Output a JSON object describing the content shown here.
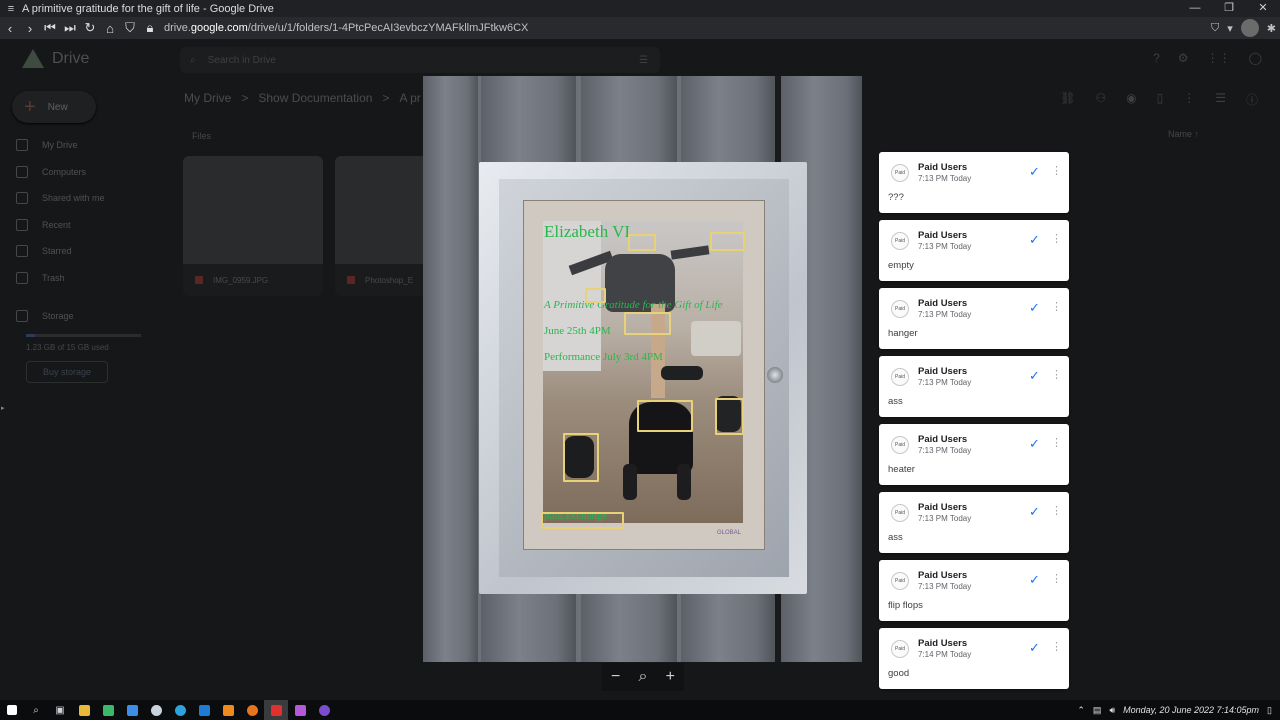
{
  "window": {
    "title": "A primitive gratitude for the gift of life - Google Drive",
    "controls": [
      "—",
      "❐",
      "✕"
    ]
  },
  "browser": {
    "url_prefix": "drive.",
    "url_host": "google.com",
    "url_path": "/drive/u/1/folders/1-4PtcPecAI3evbczYMAFkllmJFtkw6CX"
  },
  "drive": {
    "logo_text": "Drive",
    "new_label": "New",
    "search_placeholder": "Search in Drive",
    "nav": [
      "My Drive",
      "Computers",
      "Shared with me",
      "Recent",
      "Starred",
      "Trash"
    ],
    "storage_label": "Storage",
    "storage_used": "1.23 GB of 15 GB used",
    "storage_fraction": 0.082,
    "buy_storage": "Buy storage",
    "breadcrumb": [
      "My Drive",
      ">",
      "Show Documentation",
      ">",
      "A pr"
    ],
    "files_label": "Files",
    "sort_label": "Name",
    "files": [
      {
        "name": "IMG_0959.JPG"
      },
      {
        "name": "Photoshop_E"
      }
    ]
  },
  "poster": {
    "title": "Elizabeth VI",
    "subtitle": "A Primitive Gratitude for the Gift of Life",
    "date1": "June 25th 4PM",
    "date2": "Performance July 3rd 4PM",
    "footer": "paid.exchange",
    "brand": "GLOBAL"
  },
  "zoom": {
    "minus": "−",
    "zoom_icon": "⌕",
    "plus": "+"
  },
  "comments": [
    {
      "author": "Paid Users",
      "time": "7:13 PM Today",
      "text": "???",
      "avatar": "Paid"
    },
    {
      "author": "Paid Users",
      "time": "7:13 PM Today",
      "text": "empty",
      "avatar": "Paid"
    },
    {
      "author": "Paid Users",
      "time": "7:13 PM Today",
      "text": "hanger",
      "avatar": "Paid"
    },
    {
      "author": "Paid Users",
      "time": "7:13 PM Today",
      "text": "ass",
      "avatar": "Paid"
    },
    {
      "author": "Paid Users",
      "time": "7:13 PM Today",
      "text": "heater",
      "avatar": "Paid"
    },
    {
      "author": "Paid Users",
      "time": "7:13 PM Today",
      "text": "ass",
      "avatar": "Paid"
    },
    {
      "author": "Paid Users",
      "time": "7:13 PM Today",
      "text": "flip flops",
      "avatar": "Paid"
    },
    {
      "author": "Paid Users",
      "time": "7:14 PM Today",
      "text": "good",
      "avatar": "Paid"
    }
  ],
  "taskbar": {
    "clock": "Monday, 20 June 2022  7:14:05pm"
  }
}
